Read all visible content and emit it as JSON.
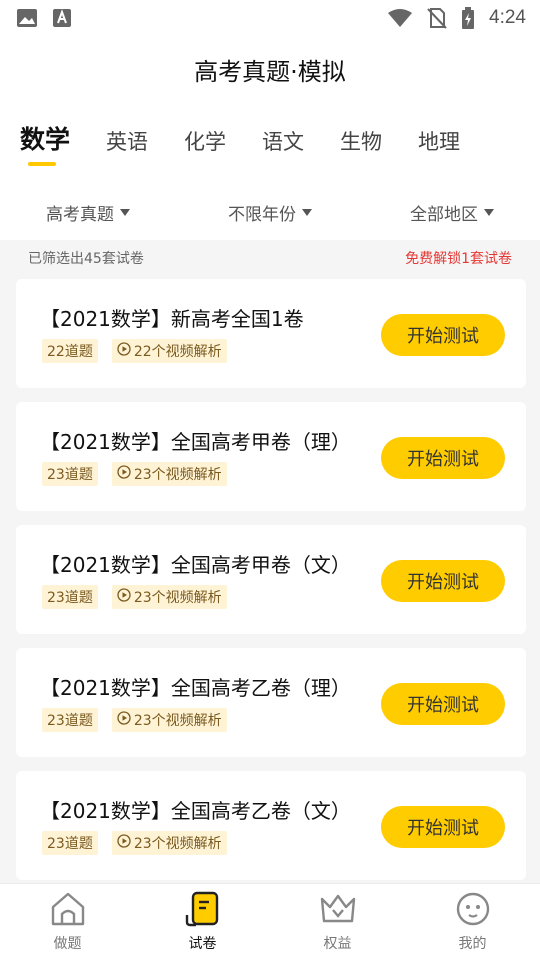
{
  "statusbar": {
    "time": "4:24",
    "icons": [
      "image-icon",
      "text-icon",
      "wifi-icon",
      "no-sim-icon",
      "battery-icon"
    ]
  },
  "header": {
    "title": "高考真题·模拟"
  },
  "tabs": [
    {
      "label": "数学",
      "active": true
    },
    {
      "label": "英语",
      "active": false
    },
    {
      "label": "化学",
      "active": false
    },
    {
      "label": "语文",
      "active": false
    },
    {
      "label": "生物",
      "active": false
    },
    {
      "label": "地理",
      "active": false
    }
  ],
  "filters": {
    "type": "高考真题",
    "year": "不限年份",
    "region": "全部地区"
  },
  "summary": {
    "count_text": "已筛选出45套试卷",
    "unlock_text": "免费解锁1套试卷"
  },
  "papers": [
    {
      "title": "【2021数学】新高考全国1卷",
      "questions": "22道题",
      "videos": "22个视频解析",
      "button": "开始测试"
    },
    {
      "title": "【2021数学】全国高考甲卷（理）",
      "questions": "23道题",
      "videos": "23个视频解析",
      "button": "开始测试"
    },
    {
      "title": "【2021数学】全国高考甲卷（文）",
      "questions": "23道题",
      "videos": "23个视频解析",
      "button": "开始测试"
    },
    {
      "title": "【2021数学】全国高考乙卷（理）",
      "questions": "23道题",
      "videos": "23个视频解析",
      "button": "开始测试"
    },
    {
      "title": "【2021数学】全国高考乙卷（文）",
      "questions": "23道题",
      "videos": "23个视频解析",
      "button": "开始测试"
    }
  ],
  "bottom_nav": [
    {
      "label": "做题",
      "icon": "home-icon",
      "active": false
    },
    {
      "label": "试卷",
      "icon": "paper-icon",
      "active": true
    },
    {
      "label": "权益",
      "icon": "crown-icon",
      "active": false
    },
    {
      "label": "我的",
      "icon": "profile-icon",
      "active": false
    }
  ],
  "colors": {
    "accent": "#ffcc00",
    "tag_bg": "#fff3d6",
    "unlock_red": "#e53935"
  }
}
